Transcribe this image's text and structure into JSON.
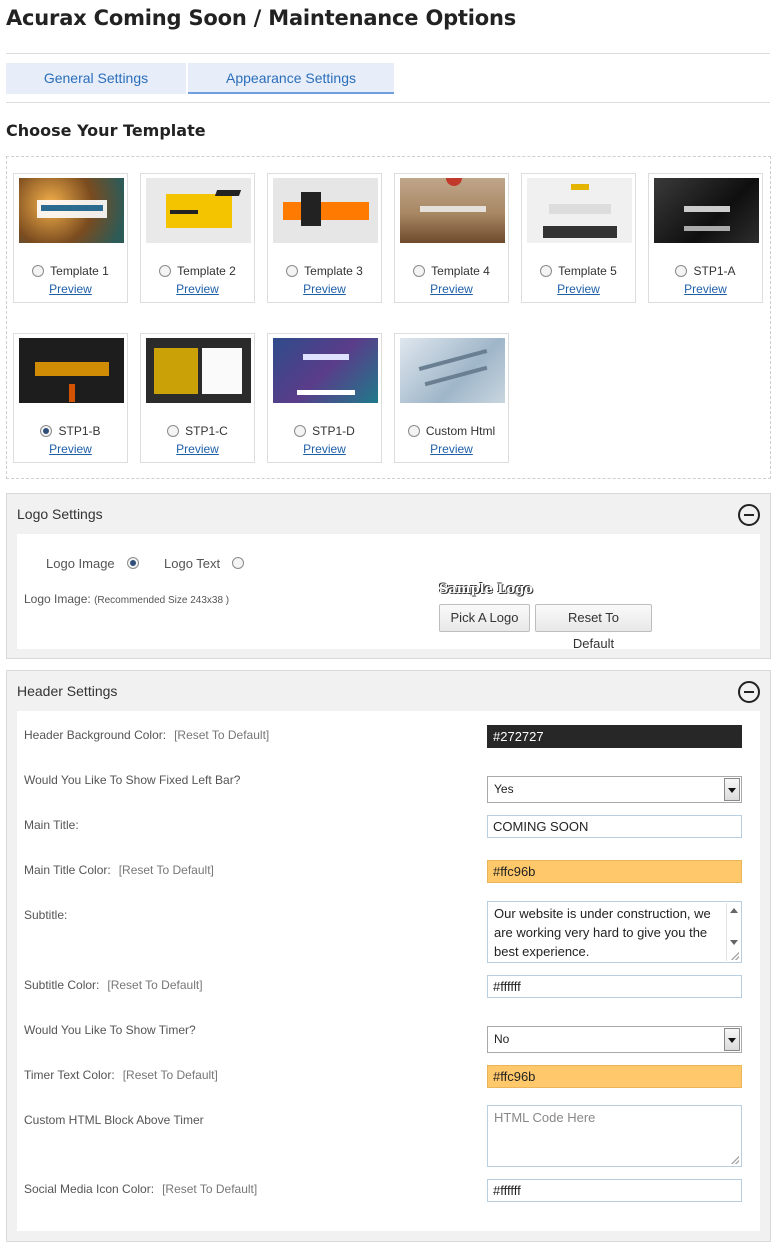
{
  "page": {
    "title": "Acurax Coming Soon / Maintenance Options"
  },
  "tabs": [
    {
      "label": "General Settings",
      "active": false
    },
    {
      "label": "Appearance Settings",
      "active": true
    }
  ],
  "templates": {
    "heading": "Choose Your Template",
    "preview_label": "Preview",
    "selected": "STP1-B",
    "items": [
      {
        "label": "Template 1"
      },
      {
        "label": "Template 2"
      },
      {
        "label": "Template 3"
      },
      {
        "label": "Template 4"
      },
      {
        "label": "Template 5"
      },
      {
        "label": "STP1-A"
      },
      {
        "label": "STP1-B"
      },
      {
        "label": "STP1-C"
      },
      {
        "label": "STP1-D"
      },
      {
        "label": "Custom Html"
      }
    ]
  },
  "logo_settings": {
    "title": "Logo Settings",
    "logo_image_option": "Logo Image",
    "logo_text_option": "Logo Text",
    "selected_option": "Logo Image",
    "logo_image_label": "Logo Image:",
    "recommended_size": "(Recommended Size 243x38 )",
    "sample_logo": "Sample Logo",
    "pick_button": "Pick A Logo",
    "reset_button": "Reset To Default"
  },
  "header_settings": {
    "title": "Header Settings",
    "reset_label": "[Reset To Default]",
    "header_bg_label": "Header Background Color:",
    "header_bg_value": "#272727",
    "fixed_left_bar_label": "Would You Like To Show Fixed Left Bar?",
    "fixed_left_bar_value": "Yes",
    "main_title_label": "Main Title:",
    "main_title_value": "COMING SOON",
    "main_title_color_label": "Main Title Color:",
    "main_title_color_value": "#ffc96b",
    "subtitle_label": "Subtitle:",
    "subtitle_value": "Our website is under construction, we are working very hard to give you the best experience.",
    "subtitle_color_label": "Subtitle Color:",
    "subtitle_color_value": "#ffffff",
    "show_timer_label": "Would You Like To Show Timer?",
    "show_timer_value": "No",
    "timer_text_color_label": "Timer Text Color:",
    "timer_text_color_value": "#ffc96b",
    "custom_html_label": "Custom HTML Block Above Timer",
    "custom_html_placeholder": "HTML Code Here",
    "social_icon_color_label": "Social Media Icon Color:",
    "social_icon_color_value": "#ffffff"
  },
  "colors": {
    "tab_bg": "#e8eef9",
    "link": "#1f5fa8",
    "header_bg_swatch": "#272727",
    "gold_swatch": "#ffc96b"
  }
}
